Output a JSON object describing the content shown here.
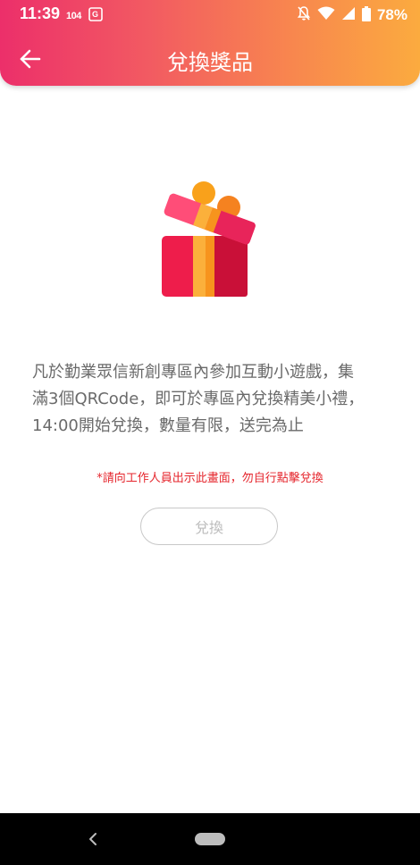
{
  "status_bar": {
    "time": "11:39",
    "left_icons": [
      "network-104-icon",
      "translate-icon"
    ],
    "network_label": "104",
    "battery_percent": "78%",
    "right_icons": [
      "notifications-off-icon",
      "wifi-icon",
      "cellular-signal-icon",
      "battery-icon"
    ]
  },
  "header": {
    "title": "兌換獎品",
    "back_icon": "arrow-left-icon",
    "gradient": [
      "#ec2f6a",
      "#fbab3f"
    ]
  },
  "main": {
    "illustration_icon": "gift-box-icon",
    "description_lines": [
      "凡於勤業眾信新創專區內參加互動小遊戲，集",
      "滿3個QRCode，即可於專區內兌換精美小禮，",
      "14:00開始兌換，數量有限，送完為止"
    ],
    "notice": "*請向工作人員出示此畫面，勿自行點擊兌換",
    "notice_color": "#e5262d",
    "redeem_button_label": "兌換"
  },
  "nav_bar": {
    "back_icon": "nav-back-icon",
    "home_icon": "nav-home-pill-icon"
  }
}
